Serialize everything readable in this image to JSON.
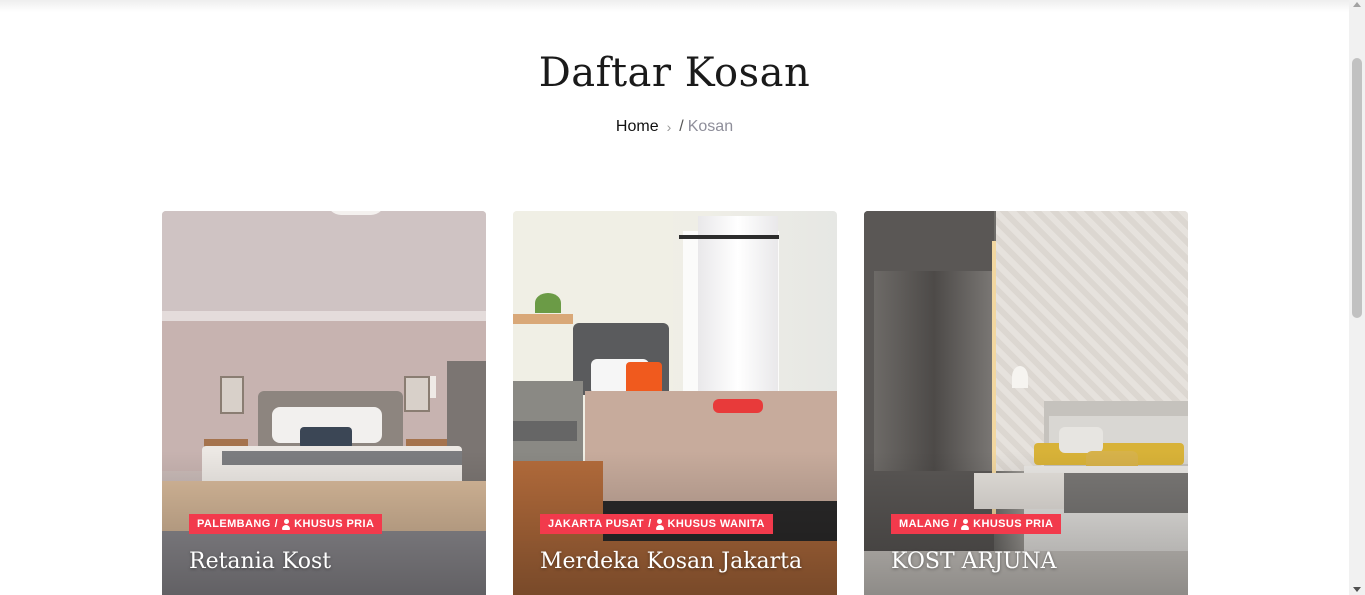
{
  "header": {
    "title": "Daftar Kosan",
    "breadcrumb": {
      "home": "Home",
      "separator_icon": "chevron-right-icon",
      "slash": "/",
      "current": "Kosan"
    }
  },
  "cards": [
    {
      "city": "PALEMBANG",
      "category": "KHUSUS PRIA",
      "name": "Retania Kost"
    },
    {
      "city": "JAKARTA PUSAT",
      "category": "KHUSUS WANITA",
      "name": "Merdeka Kosan Jakarta"
    },
    {
      "city": "MALANG",
      "category": "KHUSUS PRIA",
      "name": "KOST ARJUNA"
    }
  ],
  "tag_separator": "/",
  "colors": {
    "accent": "#f23a4c"
  }
}
